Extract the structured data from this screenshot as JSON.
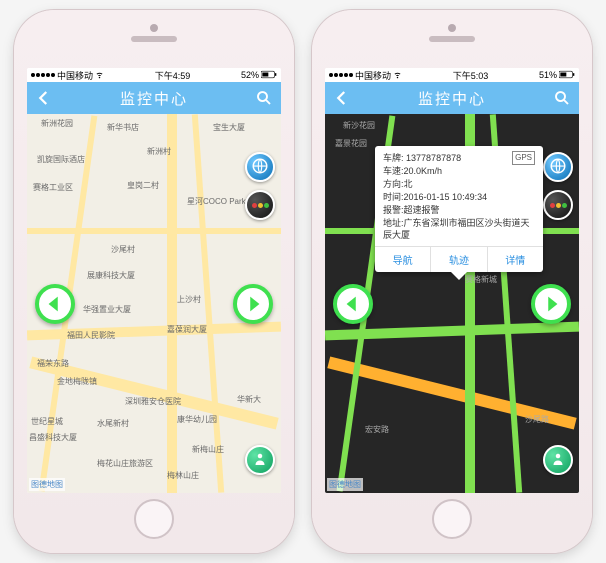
{
  "left": {
    "status": {
      "carrier": "中国移动",
      "time": "下午4:59",
      "battery": "52%"
    },
    "title": "监控中心",
    "pois": [
      "新洲花园",
      "新华书店",
      "宝生大厦",
      "凯旋国际酒店",
      "新洲村",
      "赛格工业区",
      "皇岗二村",
      "星河COCO Park",
      "展康科技大厦",
      "上沙村",
      "华强置业大厦",
      "嘉葆润大厦",
      "福田人民影院",
      "福荣东路",
      "金地梅陇镇",
      "深圳雅安仓医院",
      "昌盛科技大厦",
      "沙尾村",
      "世纪星城",
      "华新大",
      "水尾新村",
      "康华幼儿园",
      "新梅山庄",
      "梅花山庄旅游区",
      "梅林山庄"
    ],
    "attribution": "图德地图"
  },
  "right": {
    "status": {
      "carrier": "中国移动",
      "time": "下午5:03",
      "battery": "51%"
    },
    "title": "监控中心",
    "pois": [
      "新沙花园",
      "嘉景花园",
      "赛格新城",
      "宏安路",
      "沙尾路"
    ],
    "attribution": "图德地图",
    "callout": {
      "plate_label": "车牌:",
      "plate": "13778787878",
      "gps_tag": "GPS",
      "speed_label": "车速:",
      "speed": "20.0Km/h",
      "dir_label": "方向:",
      "dir": "北",
      "time_label": "时间:",
      "time": "2016-01-15 10:49:34",
      "alarm_label": "报警:",
      "alarm": "超速报警",
      "addr_label": "地址:",
      "addr": "广东省深圳市福田区沙头街道天辰大厦",
      "actions": {
        "nav": "导航",
        "track": "轨迹",
        "detail": "详情"
      }
    }
  }
}
